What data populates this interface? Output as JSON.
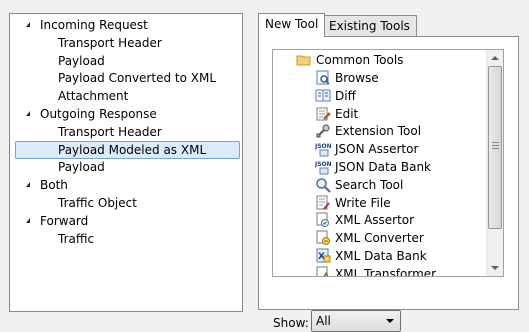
{
  "tree": {
    "items": [
      {
        "label": "Incoming Request",
        "level": 0,
        "expanded": true
      },
      {
        "label": "Transport Header",
        "level": 1
      },
      {
        "label": "Payload",
        "level": 1
      },
      {
        "label": "Payload Converted to XML",
        "level": 1
      },
      {
        "label": "Attachment",
        "level": 1
      },
      {
        "label": "Outgoing Response",
        "level": 0,
        "expanded": true
      },
      {
        "label": "Transport Header",
        "level": 1
      },
      {
        "label": "Payload Modeled as XML",
        "level": 1,
        "selected": true
      },
      {
        "label": "Payload",
        "level": 1
      },
      {
        "label": "Both",
        "level": 0,
        "expanded": true
      },
      {
        "label": "Traffic Object",
        "level": 1
      },
      {
        "label": "Forward",
        "level": 0,
        "expanded": true
      },
      {
        "label": "Traffic",
        "level": 1
      }
    ]
  },
  "tabs": [
    {
      "label": "New Tool",
      "active": true
    },
    {
      "label": "Existing Tools",
      "active": false
    }
  ],
  "tools": {
    "folder": {
      "label": "Common Tools",
      "icon": "folder-icon"
    },
    "items": [
      {
        "label": "Browse",
        "icon": "browse-icon"
      },
      {
        "label": "Diff",
        "icon": "diff-icon"
      },
      {
        "label": "Edit",
        "icon": "edit-icon"
      },
      {
        "label": "Extension Tool",
        "icon": "extension-tool-icon"
      },
      {
        "label": "JSON Assertor",
        "icon": "json-assertor-icon"
      },
      {
        "label": "JSON Data Bank",
        "icon": "json-data-bank-icon"
      },
      {
        "label": "Search Tool",
        "icon": "search-icon"
      },
      {
        "label": "Write File",
        "icon": "write-file-icon"
      },
      {
        "label": "XML Assertor",
        "icon": "xml-assertor-icon"
      },
      {
        "label": "XML Converter",
        "icon": "xml-converter-icon"
      },
      {
        "label": "XML Data Bank",
        "icon": "xml-data-bank-icon"
      },
      {
        "label": "XML Transformer",
        "icon": "xml-transformer-icon"
      }
    ]
  },
  "show": {
    "label": "Show:",
    "value": "All"
  },
  "colors": {
    "selection": "#dcebfc",
    "selection_border": "#7da2ce",
    "border": "#828790"
  }
}
